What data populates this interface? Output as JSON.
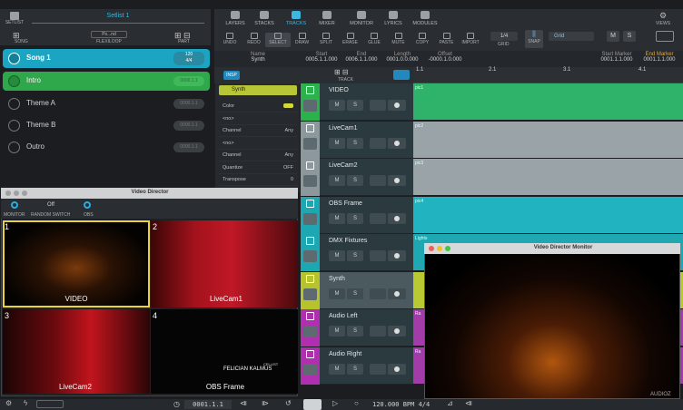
{
  "setlist": {
    "button": "SETLIST",
    "title": "Setlist 1",
    "song_label": "SONG",
    "flexiloop_label": "FLEXILOOP",
    "flexiloop_value": "Ps...nd",
    "part_label": "PART"
  },
  "songs": [
    {
      "name": "Song 1",
      "tempo": "120",
      "sig": "4/4"
    },
    {
      "name": "Intro",
      "time": "0000.1.1"
    },
    {
      "name": "Theme A",
      "time": "0000.1.1"
    },
    {
      "name": "Theme B",
      "time": "0000.1.1"
    },
    {
      "name": "Outro",
      "time": "0000.1.1"
    }
  ],
  "topmenu": [
    "LAYERS",
    "STACKS",
    "TRACKS",
    "MIXER",
    "MONITOR",
    "LYRICS",
    "MODULES"
  ],
  "views": "VIEWS",
  "tools": [
    "UNDO",
    "REDO",
    "SELECT",
    "DRAW",
    "SPLIT",
    "ERASE",
    "GLUE",
    "MUTE",
    "COPY",
    "PASTE",
    "IMPORT"
  ],
  "grid": {
    "value": "1/4",
    "label": "GRID",
    "snap": "SNAP",
    "mode": "Grid",
    "m": "M",
    "s": "S"
  },
  "info": {
    "name_h": "Name",
    "name_v": "Synth",
    "start_h": "Start",
    "start_v": "0005.1.1.000",
    "end_h": "End",
    "end_v": "0006.1.1.000",
    "length_h": "Length",
    "length_v": "0001.0.0.000",
    "offset_h": "Offset",
    "offset_v": "-0000.1.0.000",
    "sm_h": "Start Marker",
    "sm_v": "0001.1.1.000",
    "em_h": "End Marker",
    "em_v": "0001.1.1.000"
  },
  "track_label": "TRACK",
  "insp_label": "INSP",
  "ruler": [
    "1.1",
    "2.1",
    "3.1",
    "4.1"
  ],
  "inspector": {
    "name": "Synth",
    "rows": [
      {
        "k": "Color",
        "v": ""
      },
      {
        "k": "<no>",
        "v": ""
      },
      {
        "k": "Channel",
        "v": "Any"
      },
      {
        "k": "<no>",
        "v": ""
      },
      {
        "k": "Channel",
        "v": "Any"
      },
      {
        "k": "Quantize",
        "v": "OFF"
      },
      {
        "k": "Transpose",
        "v": "0"
      }
    ]
  },
  "tracks": [
    {
      "name": "VIDEO",
      "color": "#2bb24c",
      "clip": "pic1",
      "clipcolor": "#2fb36a"
    },
    {
      "name": "LiveCam1",
      "color": "#8d989d",
      "clip": "pic2",
      "clipcolor": "#9aa3a7"
    },
    {
      "name": "LiveCam2",
      "color": "#8d989d",
      "clip": "pic3",
      "clipcolor": "#9aa3a7"
    },
    {
      "name": "OBS Frame",
      "color": "#1da7b3",
      "clip": "pic4",
      "clipcolor": "#21b3c0"
    },
    {
      "name": "DMX Fixtures",
      "color": "#1da7b3",
      "clip": "Lights",
      "clipcolor": "#1fa8b2"
    },
    {
      "name": "Synth",
      "color": "#b7c32d",
      "clip": "",
      "clipcolor": "#b9c934"
    },
    {
      "name": "Audio Left",
      "color": "#b02fb0",
      "clip": "Ra",
      "clipcolor": "#a33ba8"
    },
    {
      "name": "Audio Right",
      "color": "#b02fb0",
      "clip": "Ra",
      "clipcolor": "#a33ba8"
    }
  ],
  "video_director": {
    "title": "Video Director",
    "monitor": "MONITOR",
    "random_switch": "RANDOM SWITCH",
    "random_value": "Off",
    "obs": "OBS",
    "cells": [
      {
        "n": "1",
        "label": "VIDEO"
      },
      {
        "n": "2",
        "label": "LiveCam1"
      },
      {
        "n": "3",
        "label": "LiveCam2"
      },
      {
        "n": "4",
        "label": "OBS Frame"
      }
    ],
    "obs_text1": "CELLIST",
    "obs_text2": "FELICIAN KALMUS"
  },
  "monitor_window": {
    "title": "Video Director Monitor"
  },
  "transport": {
    "position": "0001.1.1",
    "tempo": "120.000 BPM",
    "sig": "4/4"
  },
  "watermark": "AUDIOZ"
}
